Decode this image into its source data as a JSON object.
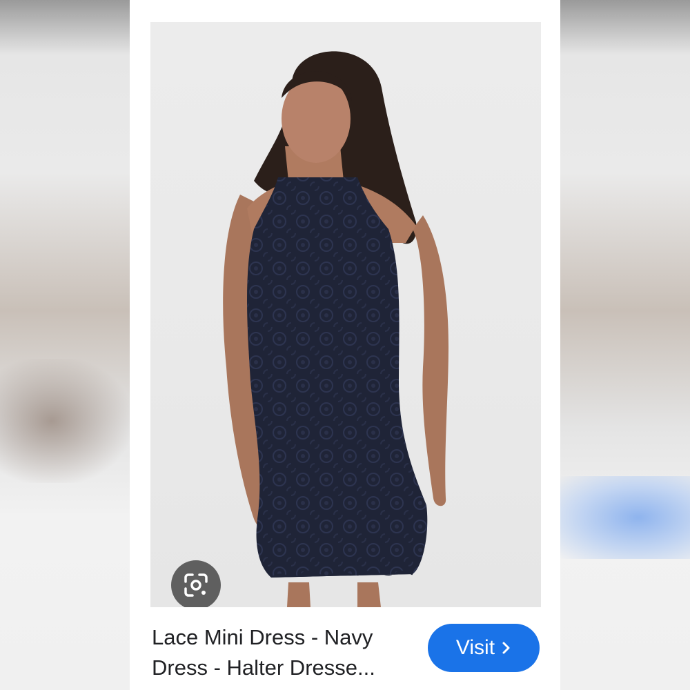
{
  "result": {
    "title_line1": "Lace Mini Dress - Navy",
    "title_line2": "Dress - Halter Dresse...",
    "visit_label": "Visit"
  },
  "icons": {
    "lens": "google-lens-icon",
    "visit_arrow": "chevron-right-icon"
  },
  "colors": {
    "visit_button": "#1a73e8",
    "dress": "#1f2437",
    "background": "#ececec"
  }
}
